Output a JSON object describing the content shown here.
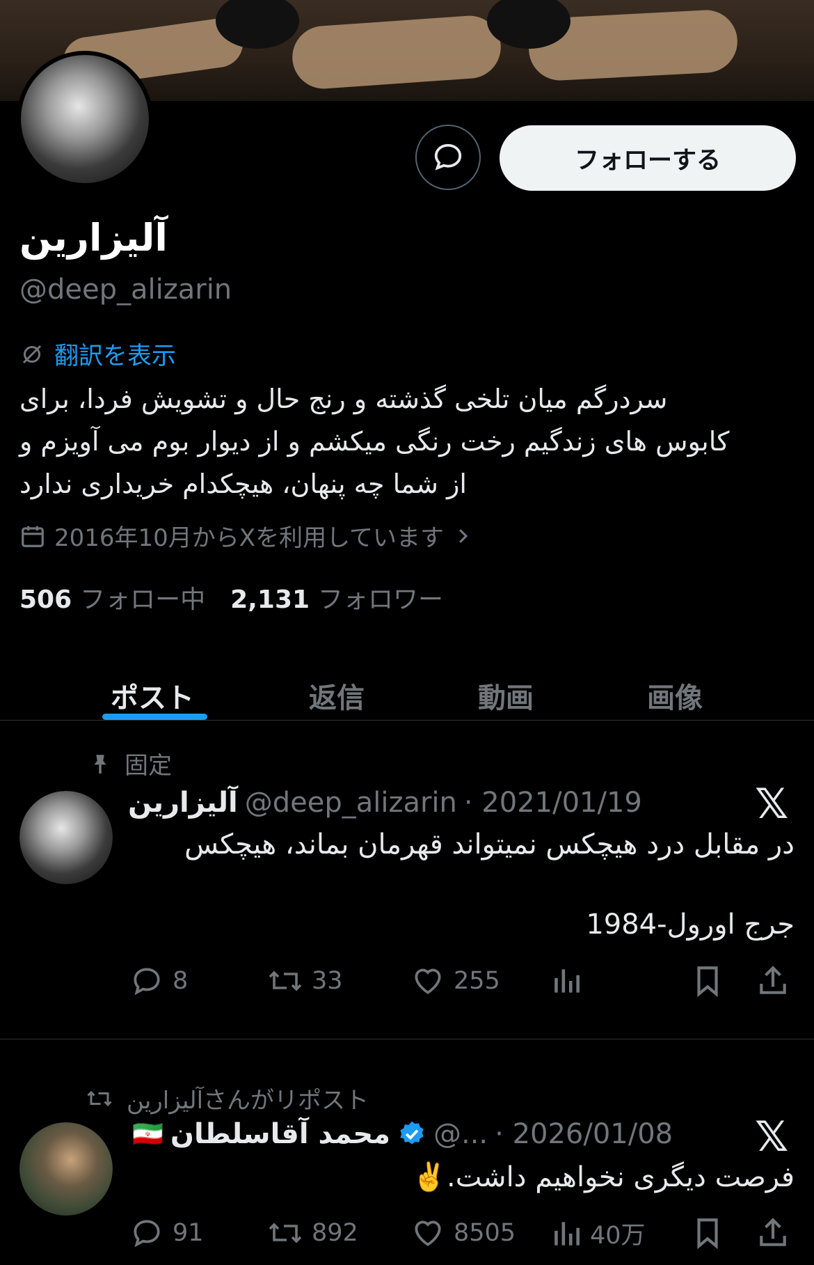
{
  "profile": {
    "name": "آلیزارین",
    "handle": "@deep_alizarin",
    "translate_label": "翻訳を表示",
    "bio": "سردرگم میان تلخی گذشته و رنج حال و تشویش فردا، برای\nکابوس های زندگیم رخت رنگی میکشم و از دیوار بوم می آویزم و\nاز شما چه پنهان، هیچکدام خریداری ندارد",
    "joined": "2016年10月からXを利用しています",
    "following_count": "506",
    "following_label": "フォロー中",
    "followers_count": "2,131",
    "followers_label": "フォロワー",
    "follow_button": "フォローする"
  },
  "tabs": [
    "ポスト",
    "返信",
    "動画",
    "画像"
  ],
  "posts": [
    {
      "context": "固定",
      "name": "آلیزارین",
      "handle": "@deep_alizarin",
      "date": "· 2021/01/19",
      "text_line1": "در مقابل درد هیچکس نمیتواند قهرمان بماند، هیچکس",
      "text_line2": "جرج اورول-1984",
      "replies": "8",
      "reposts": "33",
      "likes": "255",
      "views": ""
    },
    {
      "context": "آلیزارینさんがリポスト",
      "flag": "🇮🇷",
      "name": "محمد آقاسلطان",
      "handle": "@...",
      "date": "· 2026/01/08",
      "text_line1": "فرصت دیگری نخواهیم داشت.✌️",
      "replies": "91",
      "reposts": "892",
      "likes": "8505",
      "views": "40万"
    }
  ],
  "icons": {
    "x_logo": "𝕏"
  },
  "colors": {
    "accent": "#1d9bf0",
    "muted": "#71767b",
    "text": "#e7e9ea",
    "background": "#000000"
  }
}
